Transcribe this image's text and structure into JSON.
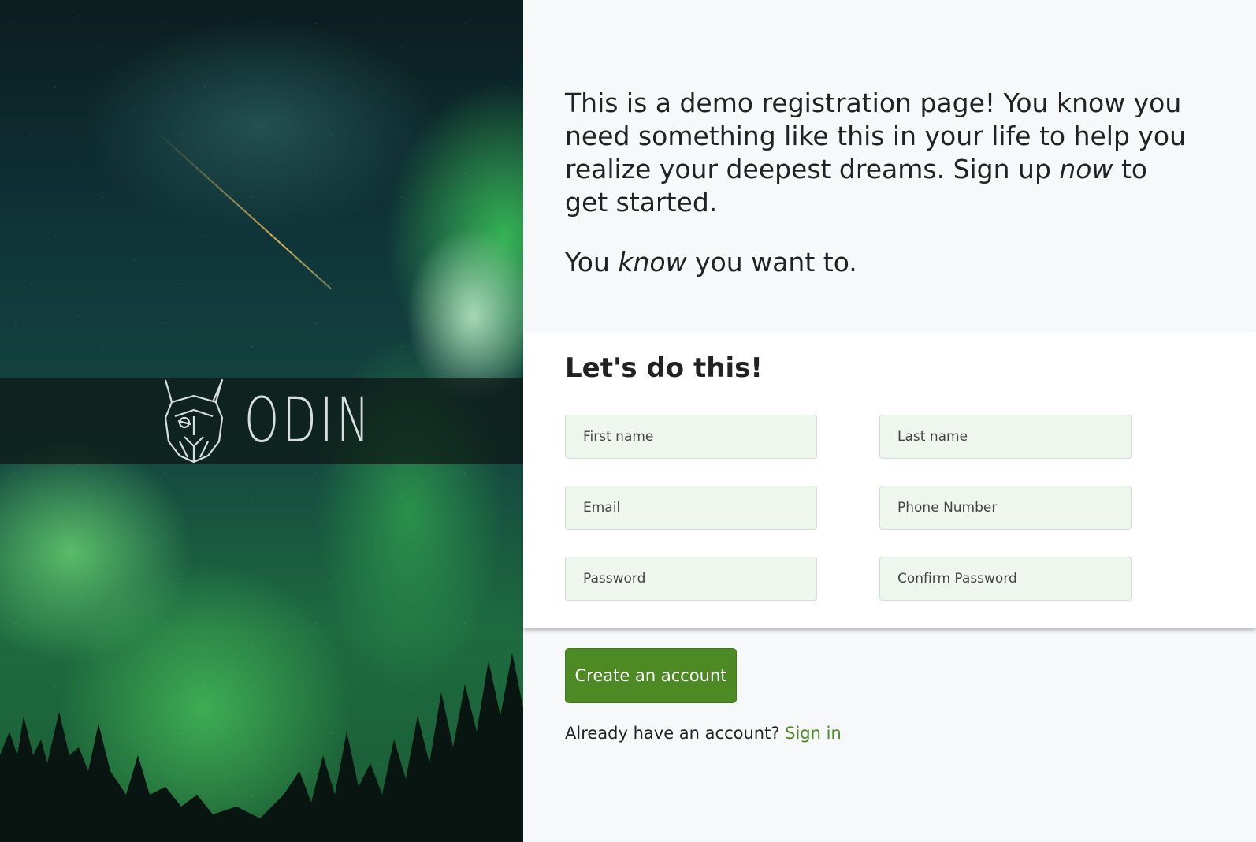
{
  "hero": {
    "logo_text": "ODIN",
    "logo_icon": "viking-helmet-icon"
  },
  "intro": {
    "line1_before": "This is a demo registration page! You know you need something like this in your life to help you realize your deepest dreams. Sign up ",
    "line1_em": "now",
    "line1_after": " to get started.",
    "line2_before": "You ",
    "line2_em": "know",
    "line2_after": " you want to."
  },
  "form": {
    "title": "Let's do this!",
    "first_name_placeholder": "First name",
    "last_name_placeholder": "Last name",
    "email_placeholder": "Email",
    "phone_placeholder": "Phone Number",
    "password_placeholder": "Password",
    "confirm_password_placeholder": "Confirm Password"
  },
  "actions": {
    "create_label": "Create an account",
    "signin_prompt": "Already have an account? ",
    "signin_label": "Sign in"
  },
  "colors": {
    "accent": "#4d8a24",
    "field_bg": "#eef6ee",
    "page_bg": "#f7f8fa"
  }
}
